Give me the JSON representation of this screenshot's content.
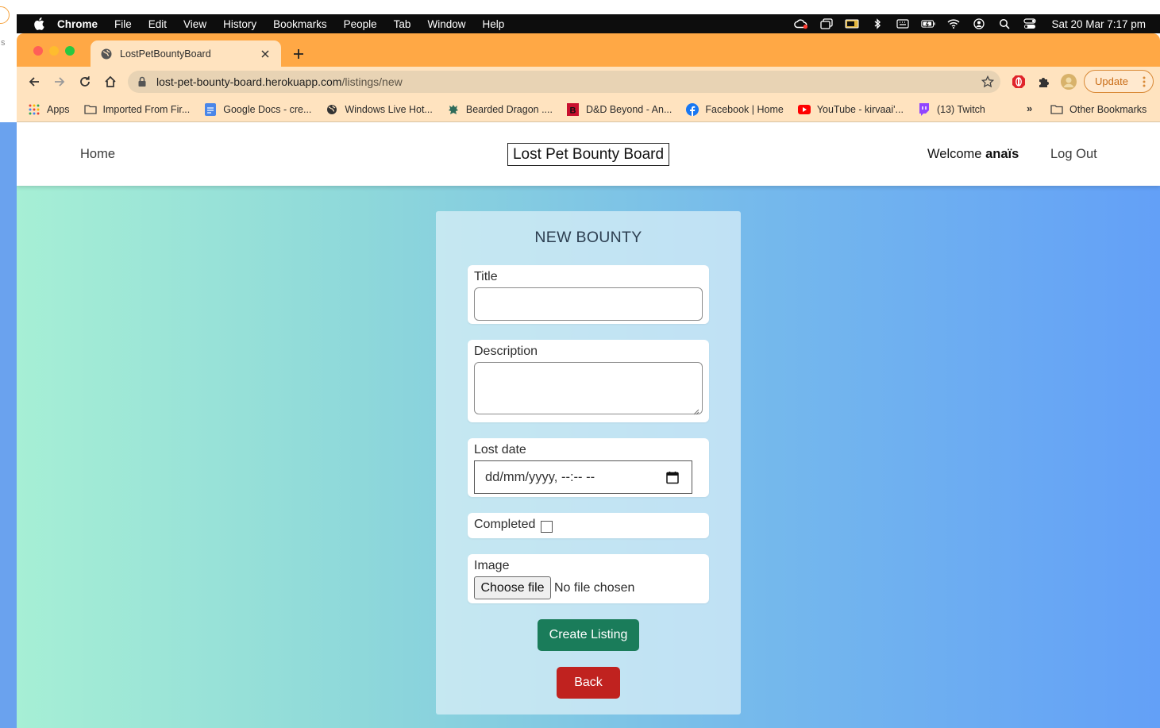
{
  "menubar": {
    "app": "Chrome",
    "items": [
      "File",
      "Edit",
      "View",
      "History",
      "Bookmarks",
      "People",
      "Tab",
      "Window",
      "Help"
    ],
    "clock": "Sat 20 Mar  7:17 pm"
  },
  "browser": {
    "tab_title": "LostPetBountyBoard",
    "url_host": "lost-pet-bounty-board.herokuapp.com",
    "url_path": "/listings/new",
    "update_label": "Update",
    "colors": {
      "frame": "#ffa845",
      "toolbar": "#ffe3bf"
    }
  },
  "bookmarks": {
    "items": [
      {
        "label": "Apps",
        "icon": "apps-grid-icon"
      },
      {
        "label": "Imported From Fir...",
        "icon": "folder-icon"
      },
      {
        "label": "Google Docs - cre...",
        "icon": "google-docs-icon"
      },
      {
        "label": "Windows Live Hot...",
        "icon": "globe-icon"
      },
      {
        "label": "Bearded Dragon ....",
        "icon": "bearded-dragon-icon"
      },
      {
        "label": "D&D Beyond - An...",
        "icon": "dnd-beyond-icon"
      },
      {
        "label": "Facebook | Home",
        "icon": "facebook-icon"
      },
      {
        "label": "YouTube - kirvaai'...",
        "icon": "youtube-icon"
      },
      {
        "label": "(13) Twitch",
        "icon": "twitch-icon"
      }
    ],
    "more": "»",
    "other": "Other Bookmarks"
  },
  "site": {
    "nav": {
      "home": "Home",
      "brand": "Lost Pet Bounty Board",
      "welcome_prefix": "Welcome ",
      "username": "anaïs",
      "logout": "Log Out"
    },
    "form": {
      "heading": "NEW BOUNTY",
      "title_label": "Title",
      "title_value": "",
      "description_label": "Description",
      "description_value": "",
      "lost_date_label": "Lost date",
      "lost_date_placeholder": "dd/mm/yyyy, --:-- --",
      "completed_label": "Completed",
      "completed_checked": false,
      "image_label": "Image",
      "choose_file_label": "Choose file",
      "no_file_text": "No file chosen",
      "submit_label": "Create Listing",
      "back_label": "Back",
      "colors": {
        "submit": "#1a7c5a",
        "back": "#c0221f"
      }
    }
  }
}
